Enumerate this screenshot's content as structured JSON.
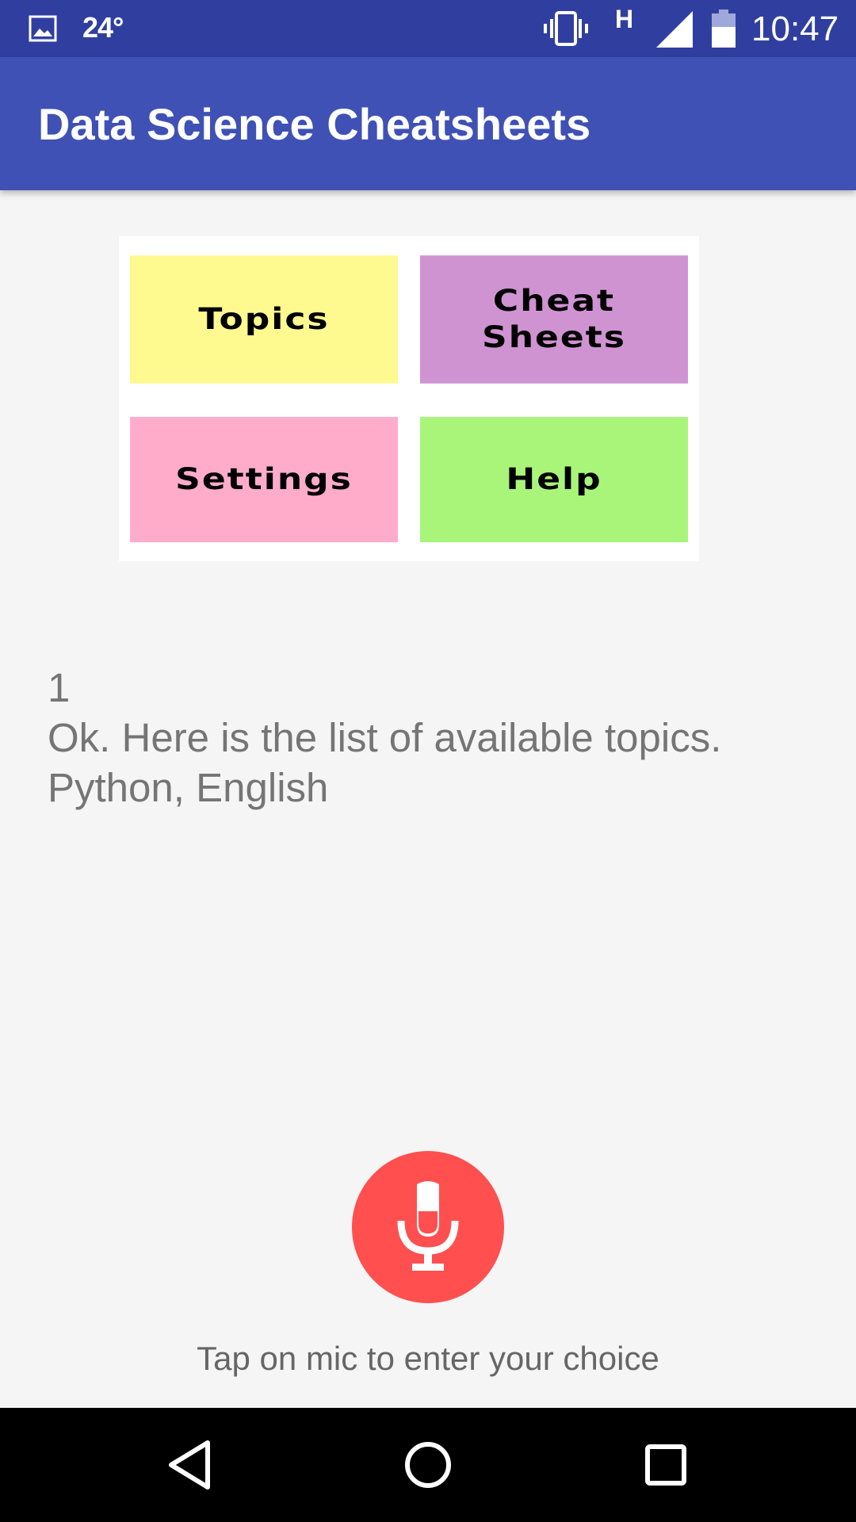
{
  "status_bar": {
    "temperature": "24°",
    "network_type": "H",
    "time": "10:47"
  },
  "app_bar": {
    "title": "Data Science Cheatsheets"
  },
  "menu_image": {
    "tiles": [
      {
        "label": "Topics",
        "color": "#fffa8f"
      },
      {
        "label": "Cheat Sheets",
        "color": "#cf93d2"
      },
      {
        "label": "Settings",
        "color": "#ffacca"
      },
      {
        "label": "Help",
        "color": "#a8f57a"
      }
    ]
  },
  "result": {
    "lines": [
      "1",
      "Ok. Here is the list of available topics.",
      "Python, English"
    ]
  },
  "mic": {
    "icon": "microphone-icon",
    "color": "#ff4f4f",
    "hint": "Tap on mic to enter your choice"
  },
  "nav_bar": {
    "icons": [
      "back-icon",
      "home-icon",
      "recents-icon"
    ]
  },
  "colors": {
    "status_bar": "#303f9f",
    "app_bar": "#3f51b5",
    "background": "#f5f5f5"
  }
}
